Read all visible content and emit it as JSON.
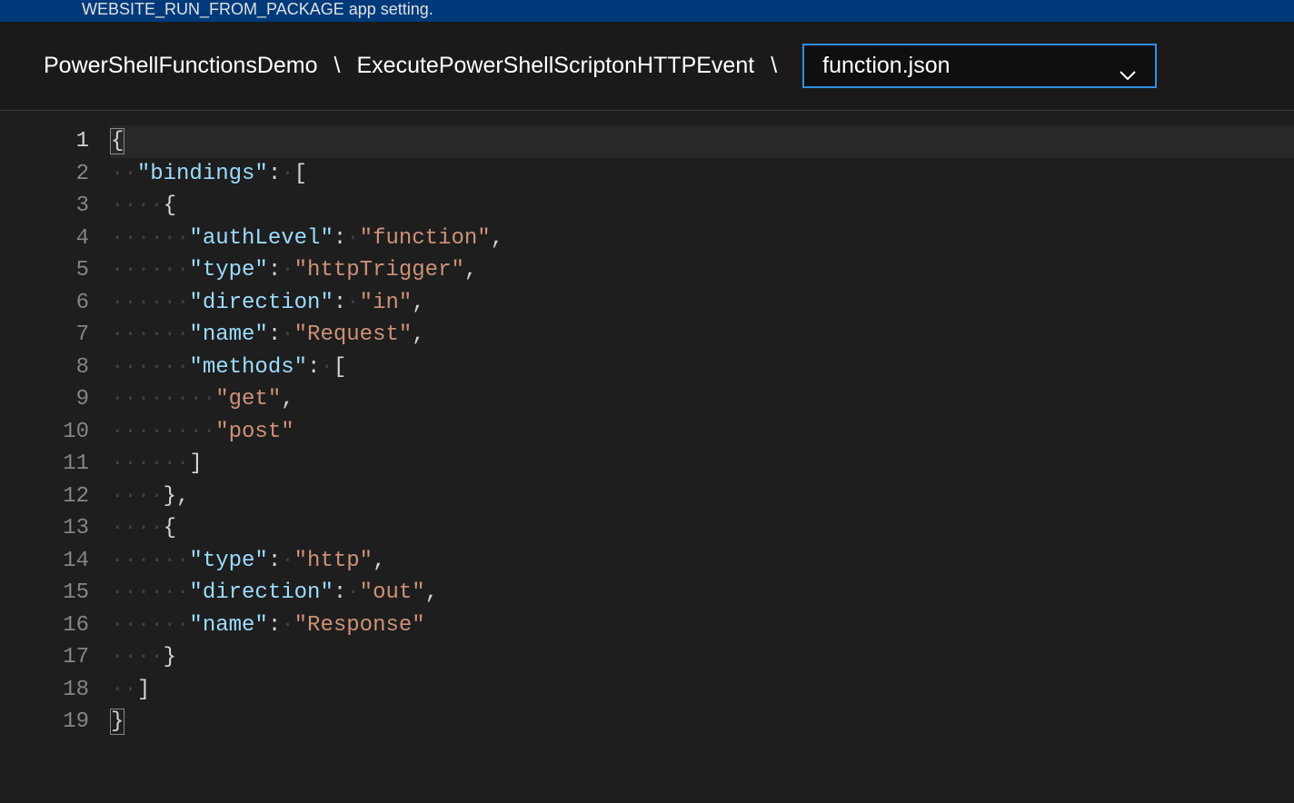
{
  "banner": {
    "text": "WEBSITE_RUN_FROM_PACKAGE app setting."
  },
  "breadcrumb": {
    "app": "PowerShellFunctionsDemo",
    "sep": "\\",
    "function": "ExecutePowerShellScriptonHTTPEvent"
  },
  "dropdown": {
    "selected": "function.json"
  },
  "code": {
    "lines": [
      {
        "n": "1",
        "ws": "",
        "tokens": [
          {
            "t": "brace",
            "v": "{"
          }
        ]
      },
      {
        "n": "2",
        "ws": "··",
        "tokens": [
          {
            "t": "key",
            "v": "\"bindings\""
          },
          {
            "t": "colon",
            "v": ":"
          },
          {
            "t": "ws",
            "v": "·"
          },
          {
            "t": "bracket",
            "v": "["
          }
        ]
      },
      {
        "n": "3",
        "ws": "····",
        "tokens": [
          {
            "t": "brace",
            "v": "{"
          }
        ]
      },
      {
        "n": "4",
        "ws": "······",
        "tokens": [
          {
            "t": "key",
            "v": "\"authLevel\""
          },
          {
            "t": "colon",
            "v": ":"
          },
          {
            "t": "ws",
            "v": "·"
          },
          {
            "t": "str",
            "v": "\"function\""
          },
          {
            "t": "comma",
            "v": ","
          }
        ]
      },
      {
        "n": "5",
        "ws": "······",
        "tokens": [
          {
            "t": "key",
            "v": "\"type\""
          },
          {
            "t": "colon",
            "v": ":"
          },
          {
            "t": "ws",
            "v": "·"
          },
          {
            "t": "str",
            "v": "\"httpTrigger\""
          },
          {
            "t": "comma",
            "v": ","
          }
        ]
      },
      {
        "n": "6",
        "ws": "······",
        "tokens": [
          {
            "t": "key",
            "v": "\"direction\""
          },
          {
            "t": "colon",
            "v": ":"
          },
          {
            "t": "ws",
            "v": "·"
          },
          {
            "t": "str",
            "v": "\"in\""
          },
          {
            "t": "comma",
            "v": ","
          }
        ]
      },
      {
        "n": "7",
        "ws": "······",
        "tokens": [
          {
            "t": "key",
            "v": "\"name\""
          },
          {
            "t": "colon",
            "v": ":"
          },
          {
            "t": "ws",
            "v": "·"
          },
          {
            "t": "str",
            "v": "\"Request\""
          },
          {
            "t": "comma",
            "v": ","
          }
        ]
      },
      {
        "n": "8",
        "ws": "······",
        "tokens": [
          {
            "t": "key",
            "v": "\"methods\""
          },
          {
            "t": "colon",
            "v": ":"
          },
          {
            "t": "ws",
            "v": "·"
          },
          {
            "t": "bracket",
            "v": "["
          }
        ]
      },
      {
        "n": "9",
        "ws": "········",
        "tokens": [
          {
            "t": "str",
            "v": "\"get\""
          },
          {
            "t": "comma",
            "v": ","
          }
        ]
      },
      {
        "n": "10",
        "ws": "········",
        "tokens": [
          {
            "t": "str",
            "v": "\"post\""
          }
        ]
      },
      {
        "n": "11",
        "ws": "······",
        "tokens": [
          {
            "t": "bracket",
            "v": "]"
          }
        ]
      },
      {
        "n": "12",
        "ws": "····",
        "tokens": [
          {
            "t": "brace",
            "v": "}"
          },
          {
            "t": "comma",
            "v": ","
          }
        ]
      },
      {
        "n": "13",
        "ws": "····",
        "tokens": [
          {
            "t": "brace",
            "v": "{"
          }
        ]
      },
      {
        "n": "14",
        "ws": "······",
        "tokens": [
          {
            "t": "key",
            "v": "\"type\""
          },
          {
            "t": "colon",
            "v": ":"
          },
          {
            "t": "ws",
            "v": "·"
          },
          {
            "t": "str",
            "v": "\"http\""
          },
          {
            "t": "comma",
            "v": ","
          }
        ]
      },
      {
        "n": "15",
        "ws": "······",
        "tokens": [
          {
            "t": "key",
            "v": "\"direction\""
          },
          {
            "t": "colon",
            "v": ":"
          },
          {
            "t": "ws",
            "v": "·"
          },
          {
            "t": "str",
            "v": "\"out\""
          },
          {
            "t": "comma",
            "v": ","
          }
        ]
      },
      {
        "n": "16",
        "ws": "······",
        "tokens": [
          {
            "t": "key",
            "v": "\"name\""
          },
          {
            "t": "colon",
            "v": ":"
          },
          {
            "t": "ws",
            "v": "·"
          },
          {
            "t": "str",
            "v": "\"Response\""
          }
        ]
      },
      {
        "n": "17",
        "ws": "····",
        "tokens": [
          {
            "t": "brace",
            "v": "}"
          }
        ]
      },
      {
        "n": "18",
        "ws": "··",
        "tokens": [
          {
            "t": "bracket",
            "v": "]"
          }
        ]
      },
      {
        "n": "19",
        "ws": "",
        "tokens": [
          {
            "t": "brace",
            "v": "}"
          }
        ]
      }
    ]
  }
}
